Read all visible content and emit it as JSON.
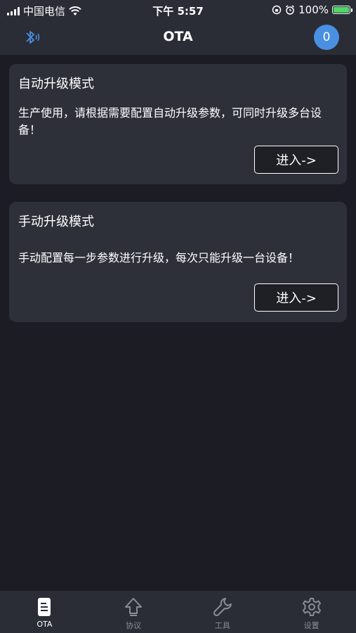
{
  "status_bar": {
    "carrier": "中国电信",
    "time": "下午 5:57",
    "battery_percent": "100%",
    "battery_level": 1.0
  },
  "nav": {
    "title": "OTA",
    "badge_count": "0"
  },
  "cards": [
    {
      "title": "自动升级模式",
      "description": "生产使用，请根据需要配置自动升级参数，可同时升级多台设备！",
      "button_label": "进入->"
    },
    {
      "title": "手动升级模式",
      "description": "手动配置每一步参数进行升级，每次只能升级一台设备！",
      "button_label": "进入->"
    }
  ],
  "tabs": [
    {
      "label": "OTA",
      "icon": "document-icon",
      "active": true
    },
    {
      "label": "协议",
      "icon": "upload-arrow-icon",
      "active": false
    },
    {
      "label": "工具",
      "icon": "wrench-icon",
      "active": false
    },
    {
      "label": "设置",
      "icon": "gear-icon",
      "active": false
    }
  ],
  "colors": {
    "background": "#1c1c24",
    "bar": "#2a2d36",
    "card": "#2e3039",
    "accent": "#4a90e2",
    "battery": "#4cd964"
  }
}
